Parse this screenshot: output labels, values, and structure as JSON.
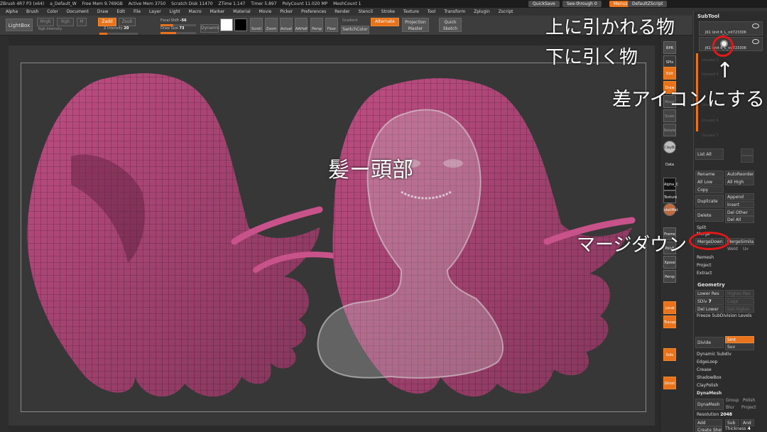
{
  "window": {
    "title_items": [
      "ZBrush 4R7 P3 (x64)",
      "a_Default_W",
      "Free Mem 9.769GB",
      "Active Mem 3750",
      "Scratch Disk 11470",
      "ZTime 1.147",
      "Timer 5.897",
      "PolyCount 11.020 MP",
      "MeshCount 1"
    ],
    "quicksave": "QuickSave",
    "seethrough": "See-through 0",
    "menus_btn": "Menus",
    "defaultzscript": "DefaultZScript"
  },
  "menubar": [
    "Alpha",
    "Brush",
    "Color",
    "Document",
    "Draw",
    "Edit",
    "File",
    "Layer",
    "Light",
    "Macro",
    "Marker",
    "Material",
    "Movie",
    "Picker",
    "Preferences",
    "Render",
    "Stencil",
    "Stroke",
    "Texture",
    "Tool",
    "Transform",
    "Zplugin",
    "Zscript"
  ],
  "toolbar": {
    "lightbox": "LightBox",
    "mrgb": "Mrgb",
    "rgb": "Rgb",
    "m": "M",
    "zadd": "Zadd",
    "zsub": "Zsub",
    "focal_label": "Focal Shift",
    "focal_value": "-56",
    "draw_label": "Draw Size",
    "draw_value": "73",
    "dynamic": "Dynamic",
    "rgb_intensity": "Rgb Intensity",
    "z_intensity_label": "Z Intensity",
    "z_intensity_value": "20",
    "scroll": "Scroll",
    "zoom": "Zoom",
    "actual": "Actual",
    "aahalf": "AAHalf",
    "persp": "Persp",
    "floor": "Floor",
    "gradient": "Gradient",
    "switchcolor": "SwitchColor",
    "alternate": "Alternate",
    "projection_master": "Projection Master",
    "quick_sketch": "Quick Sketch"
  },
  "right_tray": {
    "bpr": "BPR",
    "spix": "SPix",
    "edit": "Edit",
    "draw": "Draw",
    "move": "Move",
    "scale": "Scale",
    "rotate": "Rotate",
    "clayline": "ClayBuil",
    "data": "Data",
    "alpha": "Alpha_C",
    "texture": "Texture",
    "matcap": "sketMat",
    "frame": "Frame",
    "polyf": "PolyF",
    "transp": "Transp",
    "solo": "Solo",
    "ghost": "Ghost",
    "xpose": "Xpose",
    "local": "Local",
    "persp": "Persp"
  },
  "subtool": {
    "title": "SubTool",
    "item1": "JK1 Unit 6_L_nit723306",
    "item2": "JK1 Unit 6_L_nit723306",
    "empty1": "Unused 3",
    "empty2": "Unused 4",
    "empty3": "Unused 5",
    "empty4": "Unused 6",
    "empty5": "Unused 7",
    "list_all": "List All",
    "rename": "Rename",
    "autoreorder": "AutoReorder",
    "all_low": "All Low",
    "all_high": "All High",
    "copy": "Copy",
    "duplicate": "Duplicate",
    "append": "Append",
    "insert": "Insert",
    "delete": "Delete",
    "del_other": "Del Other",
    "del_all": "Del All",
    "split": "Split",
    "merge": "Merge",
    "mergedown": "MergeDown",
    "mergesimilar": "MergeSimilar",
    "weld": "Weld",
    "uv": "Uv",
    "remesh": "Remesh",
    "project": "Project",
    "extract": "Extract"
  },
  "geometry": {
    "title": "Geometry",
    "lower_res": "Lower Res",
    "higher_res": "Higher Res",
    "sdiv_label": "SDiv",
    "sdiv_value": "7",
    "cage": "Cage",
    "del_lower": "Del Lower",
    "del_higher": "Del Higher",
    "freeze": "Freeze SubDivision Levels",
    "divide": "Divide",
    "smt": "Smt",
    "suv": "Suv",
    "dynamic_subdiv": "Dynamic Subdiv",
    "edgeloop": "EdgeLoop",
    "crease": "Crease",
    "shadowbox": "ShadowBox",
    "claypolish": "ClayPolish",
    "dynamesh": "DynaMesh",
    "dynamesh_btn": "DynaMesh",
    "group": "Group",
    "polish": "Polish",
    "blur": "Blur",
    "project": "Project",
    "resolution_label": "Resolution",
    "resolution_value": "2048",
    "add": "Add",
    "sub": "Sub",
    "and": "And",
    "create_shell": "Create Shell",
    "thickness_label": "Thickness",
    "thickness_value": "4"
  },
  "annotations": {
    "top_item": "上に引かれる物",
    "bottom_item": "下に引く物",
    "arrow": "↑",
    "diff_icon": "差アイコンにする",
    "hair_head": "髪ー頭部",
    "mergedown": "マージダウン"
  },
  "colors": {
    "accent": "#e8731c",
    "hair": "#c8528a",
    "annotation_circle": "#e01818",
    "canvas_bg": "#373737"
  }
}
